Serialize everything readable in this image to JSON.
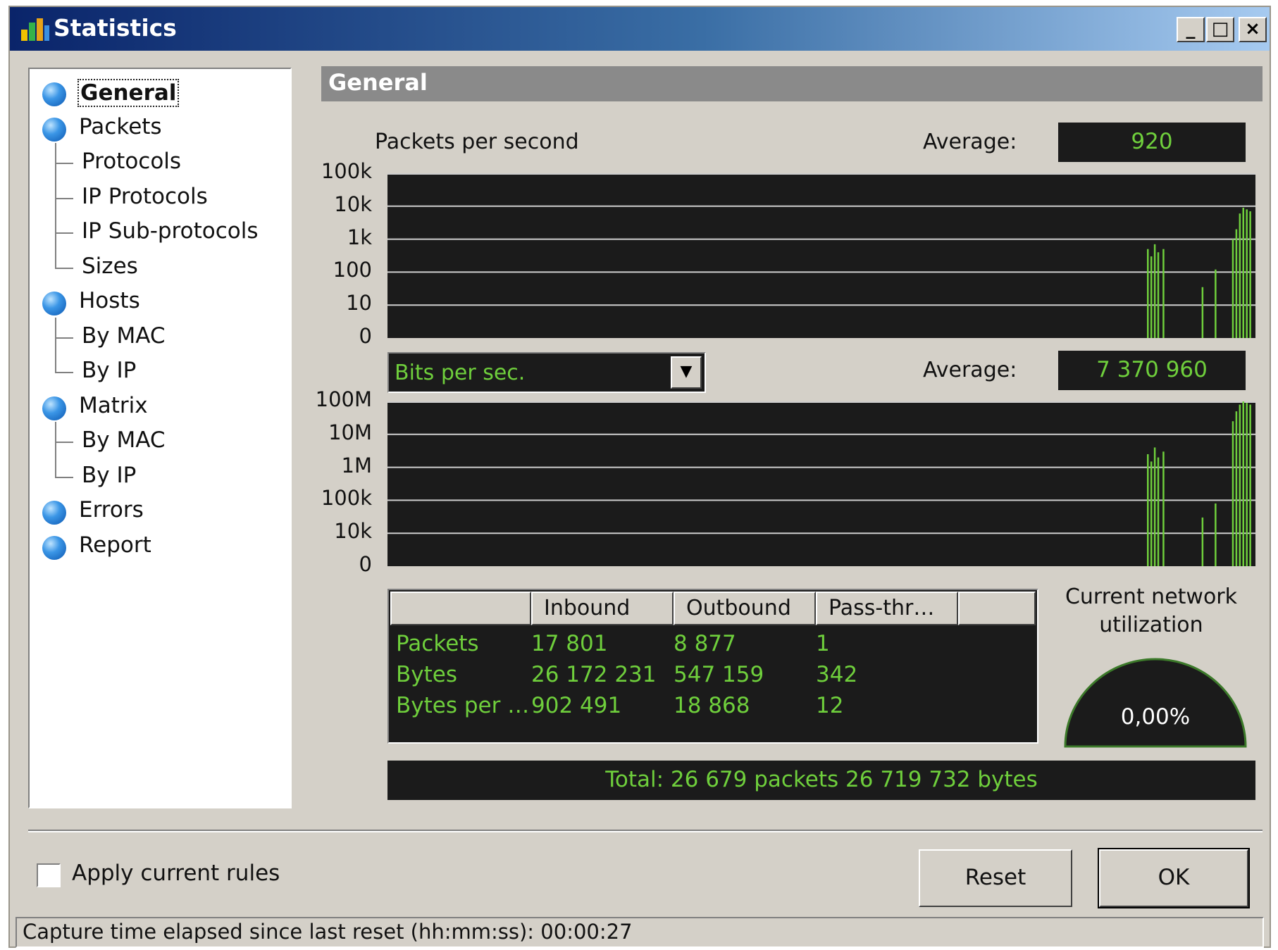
{
  "window": {
    "title": "Statistics",
    "controls": {
      "minimize": "_",
      "maximize": "□",
      "close": "×"
    }
  },
  "nav": {
    "items": [
      {
        "label": "General",
        "level": 0,
        "selected": true
      },
      {
        "label": "Packets",
        "level": 0
      },
      {
        "label": "Protocols",
        "level": 1
      },
      {
        "label": "IP Protocols",
        "level": 1
      },
      {
        "label": "IP Sub-protocols",
        "level": 1
      },
      {
        "label": "Sizes",
        "level": 1
      },
      {
        "label": "Hosts",
        "level": 0
      },
      {
        "label": "By MAC",
        "level": 1
      },
      {
        "label": "By IP",
        "level": 1
      },
      {
        "label": "Matrix",
        "level": 0
      },
      {
        "label": "By MAC",
        "level": 1
      },
      {
        "label": "By IP",
        "level": 1
      },
      {
        "label": "Errors",
        "level": 0
      },
      {
        "label": "Report",
        "level": 0
      }
    ]
  },
  "section": {
    "title": "General"
  },
  "packets_chart": {
    "label": "Packets per second",
    "average_label": "Average:",
    "average_value": "920"
  },
  "bits_chart": {
    "selector_value": "Bits per sec.",
    "average_label": "Average:",
    "average_value": "7 370 960"
  },
  "chart_data": [
    {
      "type": "bar",
      "scale": "log",
      "yticks": [
        "100k",
        "10k",
        "1k",
        "100",
        "10",
        "0"
      ],
      "ytick_values": [
        100000,
        10000,
        1000,
        100,
        10,
        1
      ],
      "grid": true,
      "series": [
        {
          "values": [
            {
              "x": 0.875,
              "y": 500
            },
            {
              "x": 0.879,
              "y": 300
            },
            {
              "x": 0.883,
              "y": 700
            },
            {
              "x": 0.887,
              "y": 400
            },
            {
              "x": 0.893,
              "y": 500
            },
            {
              "x": 0.938,
              "y": 35
            },
            {
              "x": 0.953,
              "y": 120
            },
            {
              "x": 0.973,
              "y": 1000
            },
            {
              "x": 0.977,
              "y": 2000
            },
            {
              "x": 0.981,
              "y": 6000
            },
            {
              "x": 0.985,
              "y": 9000
            },
            {
              "x": 0.989,
              "y": 8000
            },
            {
              "x": 0.993,
              "y": 7000
            }
          ]
        }
      ]
    },
    {
      "type": "bar",
      "scale": "log",
      "yticks": [
        "100M",
        "10M",
        "1M",
        "100k",
        "10k",
        "0"
      ],
      "ytick_values": [
        100000000,
        10000000,
        1000000,
        100000,
        10000,
        1000
      ],
      "grid": true,
      "series": [
        {
          "values": [
            {
              "x": 0.875,
              "y": 2500000
            },
            {
              "x": 0.879,
              "y": 1500000
            },
            {
              "x": 0.883,
              "y": 4000000
            },
            {
              "x": 0.887,
              "y": 2000000
            },
            {
              "x": 0.893,
              "y": 3000000
            },
            {
              "x": 0.938,
              "y": 30000
            },
            {
              "x": 0.953,
              "y": 80000
            },
            {
              "x": 0.973,
              "y": 25000000
            },
            {
              "x": 0.977,
              "y": 50000000
            },
            {
              "x": 0.981,
              "y": 80000000
            },
            {
              "x": 0.985,
              "y": 100000000
            },
            {
              "x": 0.989,
              "y": 90000000
            },
            {
              "x": 0.993,
              "y": 80000000
            }
          ]
        }
      ]
    }
  ],
  "stats_table": {
    "columns": [
      "",
      "Inbound",
      "Outbound",
      "Pass-thr…",
      ""
    ],
    "rows": [
      {
        "label": "Packets",
        "inbound": "17 801",
        "outbound": "8 877",
        "pass": "1"
      },
      {
        "label": "Bytes",
        "inbound": "26 172 231",
        "outbound": "547 159",
        "pass": "342"
      },
      {
        "label": "Bytes per …",
        "inbound": "902 491",
        "outbound": "18 868",
        "pass": "12"
      }
    ]
  },
  "utilization": {
    "label_line1": "Current network",
    "label_line2": "utilization",
    "value": "0,00%",
    "fraction": 0.0
  },
  "total": "Total: 26 679 packets 26 719 732 bytes",
  "footer": {
    "checkbox_label": "Apply current rules",
    "checkbox_checked": false,
    "reset_label": "Reset",
    "ok_label": "OK"
  },
  "status": "Capture time elapsed since last reset (hh:mm:ss): 00:00:27",
  "colors": {
    "accent": "#6fcf3c",
    "panel": "#1b1b1b",
    "face": "#d4d0c8"
  }
}
